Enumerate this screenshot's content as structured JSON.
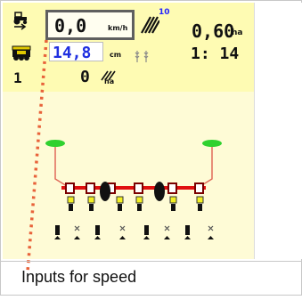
{
  "caption": "Inputs for speed",
  "speed": {
    "value": "0,0",
    "unit": "km/h"
  },
  "area": {
    "value": "0,60",
    "unit": "ha"
  },
  "tramline": {
    "interval": "10"
  },
  "depth": {
    "value": "14,8",
    "unit": "cm"
  },
  "ratio": {
    "value": "1: 14"
  },
  "counter": {
    "value": "1"
  },
  "rate": {
    "value": "0",
    "unit": "ha"
  },
  "icons": {
    "tractor": "tractor-icon",
    "tramline": "tramline-icon",
    "drill": "seed-drill-icon",
    "wheat": "wheat-icon",
    "rate": "seed-rate-icon",
    "machine": "planter-diagram-icon"
  },
  "colors": {
    "top_panel": "#fefbb3",
    "highlight_box": "#5f5f5f",
    "depth_text": "#1f2fe0",
    "callout": "#e8623a",
    "marker_arm": "#e06a5a",
    "marker_disc": "#2fd12f",
    "row_unit": "#f3f022",
    "frame": "#e01010"
  }
}
